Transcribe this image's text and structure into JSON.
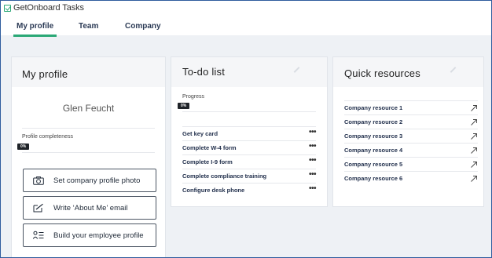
{
  "app": {
    "title": "GetOnboard Tasks"
  },
  "tabs": [
    {
      "label": "My profile",
      "active": true
    },
    {
      "label": "Team",
      "active": false
    },
    {
      "label": "Company",
      "active": false
    }
  ],
  "profile": {
    "title": "My profile",
    "name": "Glen Feucht",
    "completeness_label": "Profile completeness",
    "completeness_badge": "0%",
    "completeness_value": 0,
    "buttons": [
      {
        "label": "Set company profile photo",
        "icon": "camera-icon"
      },
      {
        "label": "Write ‘About Me’ email",
        "icon": "compose-icon"
      },
      {
        "label": "Build your employee profile",
        "icon": "profile-list-icon"
      }
    ]
  },
  "todo": {
    "title": "To-do list",
    "progress_label": "Progress",
    "progress_badge": "0%",
    "progress_value": 0,
    "items": [
      {
        "label": "Get key card"
      },
      {
        "label": "Complete W-4 form"
      },
      {
        "label": "Complete I-9 form"
      },
      {
        "label": "Complete compliance training"
      },
      {
        "label": "Configure desk phone"
      }
    ],
    "more_glyph": "•••"
  },
  "quick": {
    "title": "Quick resources",
    "items": [
      {
        "label": "Company resource 1"
      },
      {
        "label": "Company resource 2"
      },
      {
        "label": "Company resource 3"
      },
      {
        "label": "Company resource 4"
      },
      {
        "label": "Company resource 5"
      },
      {
        "label": "Company resource 6"
      }
    ]
  },
  "colors": {
    "accent": "#2aa876",
    "page_bg": "#eef1f5",
    "frame_border": "#2f5d9e"
  }
}
